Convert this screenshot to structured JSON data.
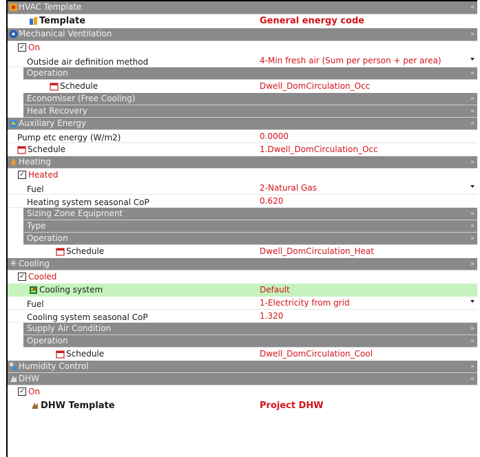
{
  "sections": {
    "hvac": {
      "title": "HVAC Template",
      "template_label": "Template",
      "template_value": "General energy code"
    },
    "mech": {
      "title": "Mechanical Ventilation",
      "on_label": "On",
      "oa_label": "Outside air definition method",
      "oa_value": "4-Min fresh air (Sum per person + per area)",
      "operation": "Operation",
      "schedule_label": "Schedule",
      "schedule_value": "Dwell_DomCirculation_Occ",
      "economiser": "Economiser (Free Cooling)",
      "heat_recovery": "Heat Recovery"
    },
    "aux": {
      "title": "Auxiliary Energy",
      "pump_label": "Pump etc energy (W/m2)",
      "pump_value": "0.0000",
      "schedule_label": "Schedule",
      "schedule_value": "1.Dwell_DomCirculation_Occ"
    },
    "heating": {
      "title": "Heating",
      "heated_label": "Heated",
      "fuel_label": "Fuel",
      "fuel_value": "2-Natural Gas",
      "cop_label": "Heating system seasonal CoP",
      "cop_value": "0.620",
      "sizing": "Sizing Zone Equipment",
      "type": "Type",
      "operation": "Operation",
      "schedule_label": "Schedule",
      "schedule_value": "Dwell_DomCirculation_Heat"
    },
    "cooling": {
      "title": "Cooling",
      "cooled_label": "Cooled",
      "system_label": "Cooling system",
      "system_value": "Default",
      "fuel_label": "Fuel",
      "fuel_value": "1-Electricity from grid",
      "cop_label": "Cooling system seasonal CoP",
      "cop_value": "1.320",
      "supply_air": "Supply Air Condition",
      "operation": "Operation",
      "schedule_label": "Schedule",
      "schedule_value": "Dwell_DomCirculation_Cool"
    },
    "humidity": {
      "title": "Humidity Control"
    },
    "dhw": {
      "title": "DHW",
      "on_label": "On",
      "template_label": "DHW Template",
      "template_value": "Project DHW"
    }
  },
  "collapse_arrow": "»",
  "check_mark": "✓",
  "colors": {
    "header": "#8a8a8a",
    "value_red": "#d3131a",
    "highlight_green": "#c6f3bd"
  },
  "icons": [
    "hvac-template-icon",
    "template-icon",
    "fan-icon",
    "schedule-icon",
    "auxiliary-icon",
    "flame-icon",
    "snowflake-icon",
    "cooling-system-icon",
    "humidity-icon",
    "dhw-icon"
  ]
}
